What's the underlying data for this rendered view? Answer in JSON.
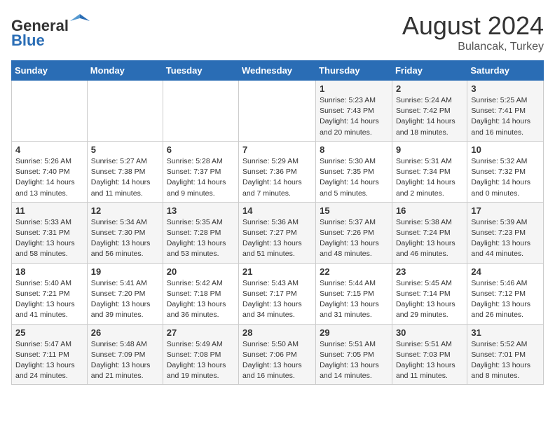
{
  "header": {
    "logo_line1": "General",
    "logo_line2": "Blue",
    "month_title": "August 2024",
    "location": "Bulancak, Turkey"
  },
  "days_of_week": [
    "Sunday",
    "Monday",
    "Tuesday",
    "Wednesday",
    "Thursday",
    "Friday",
    "Saturday"
  ],
  "weeks": [
    [
      {
        "day": "",
        "info": ""
      },
      {
        "day": "",
        "info": ""
      },
      {
        "day": "",
        "info": ""
      },
      {
        "day": "",
        "info": ""
      },
      {
        "day": "1",
        "info": "Sunrise: 5:23 AM\nSunset: 7:43 PM\nDaylight: 14 hours\nand 20 minutes."
      },
      {
        "day": "2",
        "info": "Sunrise: 5:24 AM\nSunset: 7:42 PM\nDaylight: 14 hours\nand 18 minutes."
      },
      {
        "day": "3",
        "info": "Sunrise: 5:25 AM\nSunset: 7:41 PM\nDaylight: 14 hours\nand 16 minutes."
      }
    ],
    [
      {
        "day": "4",
        "info": "Sunrise: 5:26 AM\nSunset: 7:40 PM\nDaylight: 14 hours\nand 13 minutes."
      },
      {
        "day": "5",
        "info": "Sunrise: 5:27 AM\nSunset: 7:38 PM\nDaylight: 14 hours\nand 11 minutes."
      },
      {
        "day": "6",
        "info": "Sunrise: 5:28 AM\nSunset: 7:37 PM\nDaylight: 14 hours\nand 9 minutes."
      },
      {
        "day": "7",
        "info": "Sunrise: 5:29 AM\nSunset: 7:36 PM\nDaylight: 14 hours\nand 7 minutes."
      },
      {
        "day": "8",
        "info": "Sunrise: 5:30 AM\nSunset: 7:35 PM\nDaylight: 14 hours\nand 5 minutes."
      },
      {
        "day": "9",
        "info": "Sunrise: 5:31 AM\nSunset: 7:34 PM\nDaylight: 14 hours\nand 2 minutes."
      },
      {
        "day": "10",
        "info": "Sunrise: 5:32 AM\nSunset: 7:32 PM\nDaylight: 14 hours\nand 0 minutes."
      }
    ],
    [
      {
        "day": "11",
        "info": "Sunrise: 5:33 AM\nSunset: 7:31 PM\nDaylight: 13 hours\nand 58 minutes."
      },
      {
        "day": "12",
        "info": "Sunrise: 5:34 AM\nSunset: 7:30 PM\nDaylight: 13 hours\nand 56 minutes."
      },
      {
        "day": "13",
        "info": "Sunrise: 5:35 AM\nSunset: 7:28 PM\nDaylight: 13 hours\nand 53 minutes."
      },
      {
        "day": "14",
        "info": "Sunrise: 5:36 AM\nSunset: 7:27 PM\nDaylight: 13 hours\nand 51 minutes."
      },
      {
        "day": "15",
        "info": "Sunrise: 5:37 AM\nSunset: 7:26 PM\nDaylight: 13 hours\nand 48 minutes."
      },
      {
        "day": "16",
        "info": "Sunrise: 5:38 AM\nSunset: 7:24 PM\nDaylight: 13 hours\nand 46 minutes."
      },
      {
        "day": "17",
        "info": "Sunrise: 5:39 AM\nSunset: 7:23 PM\nDaylight: 13 hours\nand 44 minutes."
      }
    ],
    [
      {
        "day": "18",
        "info": "Sunrise: 5:40 AM\nSunset: 7:21 PM\nDaylight: 13 hours\nand 41 minutes."
      },
      {
        "day": "19",
        "info": "Sunrise: 5:41 AM\nSunset: 7:20 PM\nDaylight: 13 hours\nand 39 minutes."
      },
      {
        "day": "20",
        "info": "Sunrise: 5:42 AM\nSunset: 7:18 PM\nDaylight: 13 hours\nand 36 minutes."
      },
      {
        "day": "21",
        "info": "Sunrise: 5:43 AM\nSunset: 7:17 PM\nDaylight: 13 hours\nand 34 minutes."
      },
      {
        "day": "22",
        "info": "Sunrise: 5:44 AM\nSunset: 7:15 PM\nDaylight: 13 hours\nand 31 minutes."
      },
      {
        "day": "23",
        "info": "Sunrise: 5:45 AM\nSunset: 7:14 PM\nDaylight: 13 hours\nand 29 minutes."
      },
      {
        "day": "24",
        "info": "Sunrise: 5:46 AM\nSunset: 7:12 PM\nDaylight: 13 hours\nand 26 minutes."
      }
    ],
    [
      {
        "day": "25",
        "info": "Sunrise: 5:47 AM\nSunset: 7:11 PM\nDaylight: 13 hours\nand 24 minutes."
      },
      {
        "day": "26",
        "info": "Sunrise: 5:48 AM\nSunset: 7:09 PM\nDaylight: 13 hours\nand 21 minutes."
      },
      {
        "day": "27",
        "info": "Sunrise: 5:49 AM\nSunset: 7:08 PM\nDaylight: 13 hours\nand 19 minutes."
      },
      {
        "day": "28",
        "info": "Sunrise: 5:50 AM\nSunset: 7:06 PM\nDaylight: 13 hours\nand 16 minutes."
      },
      {
        "day": "29",
        "info": "Sunrise: 5:51 AM\nSunset: 7:05 PM\nDaylight: 13 hours\nand 14 minutes."
      },
      {
        "day": "30",
        "info": "Sunrise: 5:51 AM\nSunset: 7:03 PM\nDaylight: 13 hours\nand 11 minutes."
      },
      {
        "day": "31",
        "info": "Sunrise: 5:52 AM\nSunset: 7:01 PM\nDaylight: 13 hours\nand 8 minutes."
      }
    ]
  ]
}
